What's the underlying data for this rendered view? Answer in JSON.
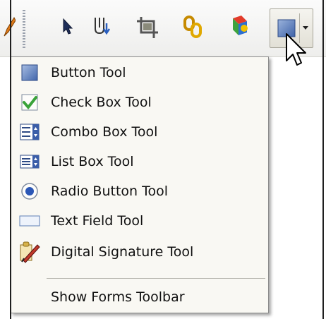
{
  "menu": {
    "items": [
      {
        "label": "Button Tool",
        "icon": "button-tool-icon"
      },
      {
        "label": "Check Box Tool",
        "icon": "check-box-tool-icon"
      },
      {
        "label": "Combo Box Tool",
        "icon": "combo-box-tool-icon"
      },
      {
        "label": "List Box Tool",
        "icon": "list-box-tool-icon"
      },
      {
        "label": "Radio Button Tool",
        "icon": "radio-button-tool-icon"
      },
      {
        "label": "Text Field Tool",
        "icon": "text-field-tool-icon"
      },
      {
        "label": "Digital Signature Tool",
        "icon": "digital-signature-tool-icon"
      }
    ],
    "footer_item": {
      "label": "Show Forms Toolbar"
    }
  },
  "toolbar": {
    "icons": [
      "pencil-icon",
      "select-arrow-icon",
      "touchup-icon",
      "crop-icon",
      "link-icon",
      "3d-object-icon",
      "button-tool-icon"
    ]
  },
  "colors": {
    "menu_background": "#f9f8f3",
    "check_green": "#3aa33a",
    "radio_blue": "#2b57b6",
    "button_blue": "#6b8ec7"
  }
}
